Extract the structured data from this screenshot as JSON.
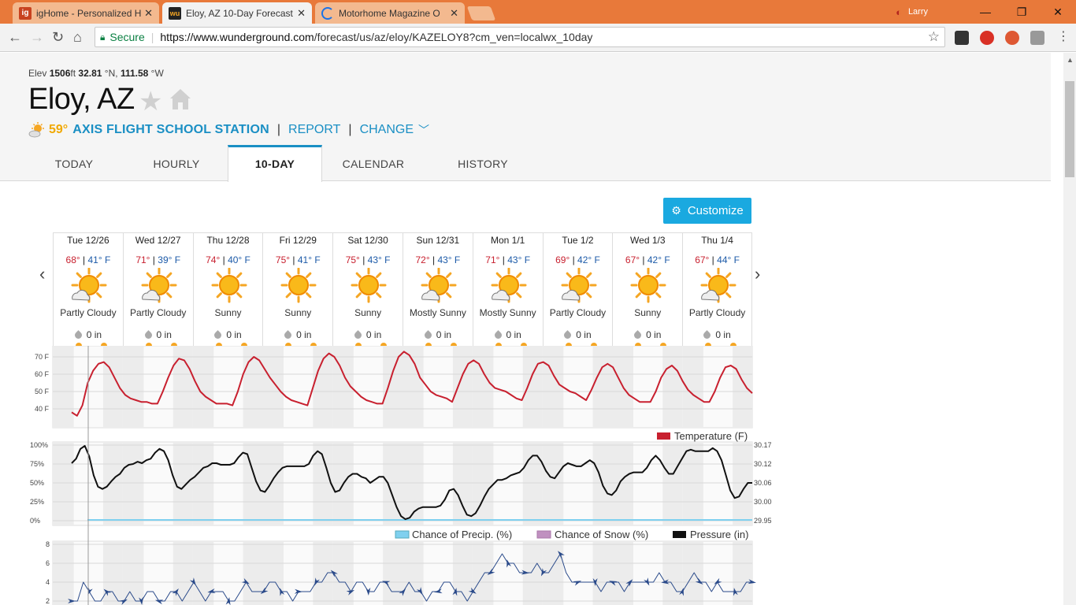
{
  "browser": {
    "tabs": [
      {
        "title": "igHome - Personalized H",
        "color": "#c8421f"
      },
      {
        "title": "Eloy, AZ 10-Day Forecast",
        "color": "#222222"
      },
      {
        "title": "Motorhome Magazine O",
        "color": "#1a73e8"
      }
    ],
    "user": "Larry",
    "url_host": "https://www.wunderground.com",
    "url_path": "/forecast/us/az/eloy/KAZELOY8?cm_ven=localwx_10day",
    "secure_label": "Secure"
  },
  "location": {
    "elev_label": "Elev",
    "elev_value": "1506",
    "elev_unit": "ft",
    "lat": "32.81",
    "lat_unit": "°N,",
    "lon": "111.58",
    "lon_unit": "°W",
    "city": "Eloy, AZ",
    "current_temp": "59°",
    "station": "AXIS FLIGHT SCHOOL STATION",
    "report": "REPORT",
    "change": "CHANGE"
  },
  "nav": {
    "tabs": [
      "TODAY",
      "HOURLY",
      "10-DAY",
      "CALENDAR",
      "HISTORY"
    ],
    "active": "10-DAY"
  },
  "customize_label": "Customize",
  "days": [
    {
      "name": "Tue 12/26",
      "hi": "68°",
      "lo": "41° F",
      "cond": "Partly Cloudy",
      "icon": "partly-cloudy",
      "precip": "0 in"
    },
    {
      "name": "Wed 12/27",
      "hi": "71°",
      "lo": "39° F",
      "cond": "Partly Cloudy",
      "icon": "partly-cloudy",
      "precip": "0 in"
    },
    {
      "name": "Thu 12/28",
      "hi": "74°",
      "lo": "40° F",
      "cond": "Sunny",
      "icon": "sunny",
      "precip": "0 in"
    },
    {
      "name": "Fri 12/29",
      "hi": "75°",
      "lo": "41° F",
      "cond": "Sunny",
      "icon": "sunny",
      "precip": "0 in"
    },
    {
      "name": "Sat 12/30",
      "hi": "75°",
      "lo": "43° F",
      "cond": "Sunny",
      "icon": "sunny",
      "precip": "0 in"
    },
    {
      "name": "Sun 12/31",
      "hi": "72°",
      "lo": "43° F",
      "cond": "Mostly Sunny",
      "icon": "partly-cloudy",
      "precip": "0 in"
    },
    {
      "name": "Mon 1/1",
      "hi": "71°",
      "lo": "43° F",
      "cond": "Mostly Sunny",
      "icon": "partly-cloudy",
      "precip": "0 in"
    },
    {
      "name": "Tue 1/2",
      "hi": "69°",
      "lo": "42° F",
      "cond": "Partly Cloudy",
      "icon": "partly-cloudy",
      "precip": "0 in"
    },
    {
      "name": "Wed 1/3",
      "hi": "67°",
      "lo": "42° F",
      "cond": "Sunny",
      "icon": "sunny",
      "precip": "0 in"
    },
    {
      "name": "Thu 1/4",
      "hi": "67°",
      "lo": "44° F",
      "cond": "Partly Cloudy",
      "icon": "partly-cloudy",
      "precip": "0 in"
    }
  ],
  "colors": {
    "temp_line": "#c8202f",
    "pressure_line": "#111111",
    "precip": "#7fd0ef",
    "snow": "#c090c0",
    "wind": "#2a4a8a",
    "accent": "#1a8fc4"
  },
  "chart_data": [
    {
      "type": "line",
      "name": "temperature",
      "ylabels": [
        "70 F",
        "60 F",
        "50 F",
        "40 F"
      ],
      "ylim": [
        40,
        70
      ],
      "series": [
        {
          "name": "Temperature (F)",
          "values": [
            38,
            36,
            42,
            55,
            62,
            66,
            67,
            64,
            58,
            52,
            48,
            46,
            45,
            44,
            44,
            43,
            43,
            50,
            58,
            65,
            69,
            68,
            63,
            56,
            50,
            47,
            45,
            43,
            43,
            43,
            42,
            50,
            60,
            67,
            70,
            68,
            63,
            58,
            54,
            50,
            47,
            45,
            44,
            43,
            42,
            52,
            62,
            69,
            72,
            70,
            65,
            58,
            53,
            50,
            47,
            45,
            44,
            43,
            43,
            52,
            62,
            70,
            73,
            71,
            66,
            58,
            54,
            50,
            48,
            47,
            46,
            44,
            52,
            60,
            66,
            68,
            66,
            60,
            55,
            52,
            51,
            50,
            48,
            46,
            45,
            52,
            60,
            66,
            67,
            65,
            59,
            54,
            52,
            50,
            49,
            47,
            45,
            51,
            58,
            64,
            66,
            64,
            58,
            52,
            48,
            46,
            44,
            44,
            44,
            50,
            58,
            63,
            65,
            62,
            56,
            51,
            48,
            46,
            44,
            44,
            50,
            58,
            64,
            65,
            63,
            57,
            52,
            49
          ]
        }
      ],
      "legend": [
        "Temperature (F)"
      ]
    },
    {
      "type": "line",
      "name": "precip-pressure",
      "ylabels_left": [
        "100%",
        "75%",
        "50%",
        "25%",
        "0%"
      ],
      "ylabels_right": [
        "30.17",
        "30.12",
        "30.06",
        "30.00",
        "29.95"
      ],
      "ylim": [
        0,
        100
      ],
      "series": [
        {
          "name": "Pressure (in)",
          "values": [
            76,
            82,
            95,
            99,
            85,
            60,
            45,
            42,
            45,
            52,
            58,
            62,
            70,
            74,
            75,
            78,
            76,
            80,
            82,
            90,
            95,
            92,
            80,
            60,
            45,
            42,
            48,
            54,
            58,
            64,
            70,
            72,
            76,
            76,
            74,
            74,
            74,
            76,
            84,
            90,
            88,
            70,
            52,
            40,
            38,
            46,
            56,
            64,
            70,
            72,
            72,
            72,
            72,
            72,
            75,
            86,
            92,
            88,
            70,
            50,
            38,
            40,
            50,
            58,
            62,
            62,
            58,
            56,
            50,
            54,
            58,
            58,
            50,
            34,
            18,
            6,
            2,
            4,
            12,
            16,
            18,
            18,
            18,
            18,
            20,
            28,
            40,
            42,
            34,
            20,
            8,
            6,
            10,
            20,
            32,
            42,
            48,
            54,
            54,
            56,
            60,
            62,
            64,
            70,
            80,
            86,
            86,
            78,
            66,
            58,
            56,
            64,
            72,
            76,
            74,
            72,
            72,
            76,
            80,
            76,
            64,
            46,
            36,
            34,
            40,
            52,
            58,
            62,
            64,
            64,
            64,
            70,
            80,
            86,
            80,
            70,
            62,
            62,
            72,
            82,
            92,
            94,
            92,
            92,
            92,
            92,
            96,
            92,
            80,
            60,
            40,
            30,
            32,
            42,
            50,
            50
          ]
        },
        {
          "name": "Chance of Precip. (%)",
          "values": [
            0
          ]
        },
        {
          "name": "Chance of Snow (%)",
          "values": [
            0
          ]
        }
      ],
      "legend": [
        "Chance of Precip. (%)",
        "Chance of Snow (%)",
        "Pressure (in)"
      ]
    },
    {
      "type": "line",
      "name": "wind",
      "ylabels": [
        "8",
        "6",
        "4",
        "2"
      ],
      "ylim": [
        0,
        8
      ],
      "series": [
        {
          "name": "wind",
          "values": [
            2,
            2,
            4,
            3,
            2,
            2,
            3,
            3,
            2,
            2,
            3,
            2,
            2,
            3,
            3,
            2,
            2,
            3,
            3,
            2,
            3,
            4,
            3,
            2,
            3,
            3,
            3,
            2,
            2,
            3,
            4,
            3,
            3,
            3,
            4,
            4,
            3,
            3,
            2,
            3,
            3,
            3,
            4,
            4,
            5,
            5,
            4,
            4,
            3,
            4,
            4,
            3,
            3,
            4,
            4,
            3,
            3,
            3,
            4,
            3,
            3,
            2,
            3,
            3,
            4,
            4,
            3,
            3,
            2,
            3,
            4,
            5,
            5,
            6,
            7,
            6,
            6,
            5,
            5,
            5,
            6,
            5,
            5,
            6,
            7,
            5,
            4,
            4,
            4,
            4,
            4,
            3,
            4,
            4,
            4,
            3,
            4,
            4,
            4,
            4,
            4,
            5,
            4,
            4,
            3,
            3,
            4,
            5,
            4,
            4,
            3,
            4,
            3,
            3,
            3,
            3,
            4,
            4
          ]
        }
      ]
    }
  ]
}
